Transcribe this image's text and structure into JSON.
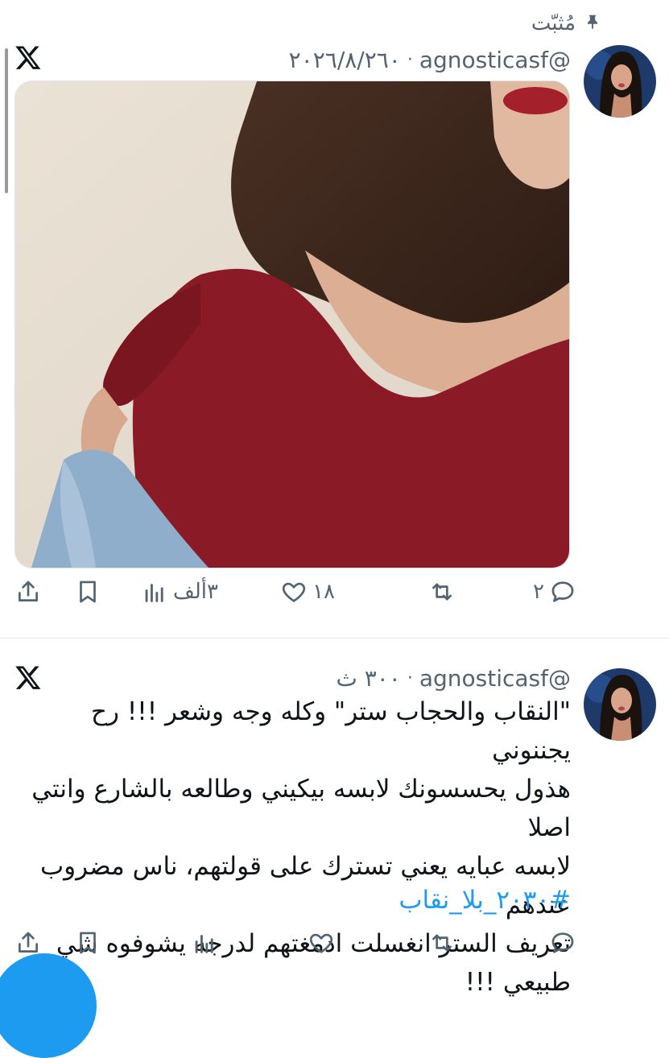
{
  "pinned": {
    "label": "مُثبّت",
    "icon": "pin-icon"
  },
  "tweets": [
    {
      "handle": "@agnosticasf",
      "separator": "·",
      "time": "٢٠٢٦/٨/٢٦٠",
      "text_lines": [],
      "hashtag": "",
      "has_media": true,
      "media_icon": "photo-woman-red-top",
      "actions": {
        "replies": "٢",
        "retweets": "",
        "likes": "١٨",
        "views": "٣ألف"
      }
    },
    {
      "handle": "@agnosticasf",
      "separator": "·",
      "time": "٣٠٠ ث",
      "text_lines": [
        "\"النقاب والحجاب ستر\" وكله وجه وشعر !!! رح يجننوني",
        "هذول يحسسونك لابسه بيكيني وطالعه بالشارع وانتي اصلا",
        "لابسه عبايه يعني تسترك على قولتهم، ناس مضروب عندهم",
        "تعريف الستر انغسلت ادمغتهم لدرجه يشوفوه شي",
        "طبيعي !!!"
      ],
      "hashtag": "#٢٠٣٠_بلا_نقاب",
      "has_media": false,
      "actions": {
        "replies": "",
        "retweets": "",
        "likes": "",
        "views": ""
      }
    }
  ],
  "colors": {
    "accent": "#1d9bf0",
    "muted": "#536471",
    "text": "#0f1419"
  }
}
